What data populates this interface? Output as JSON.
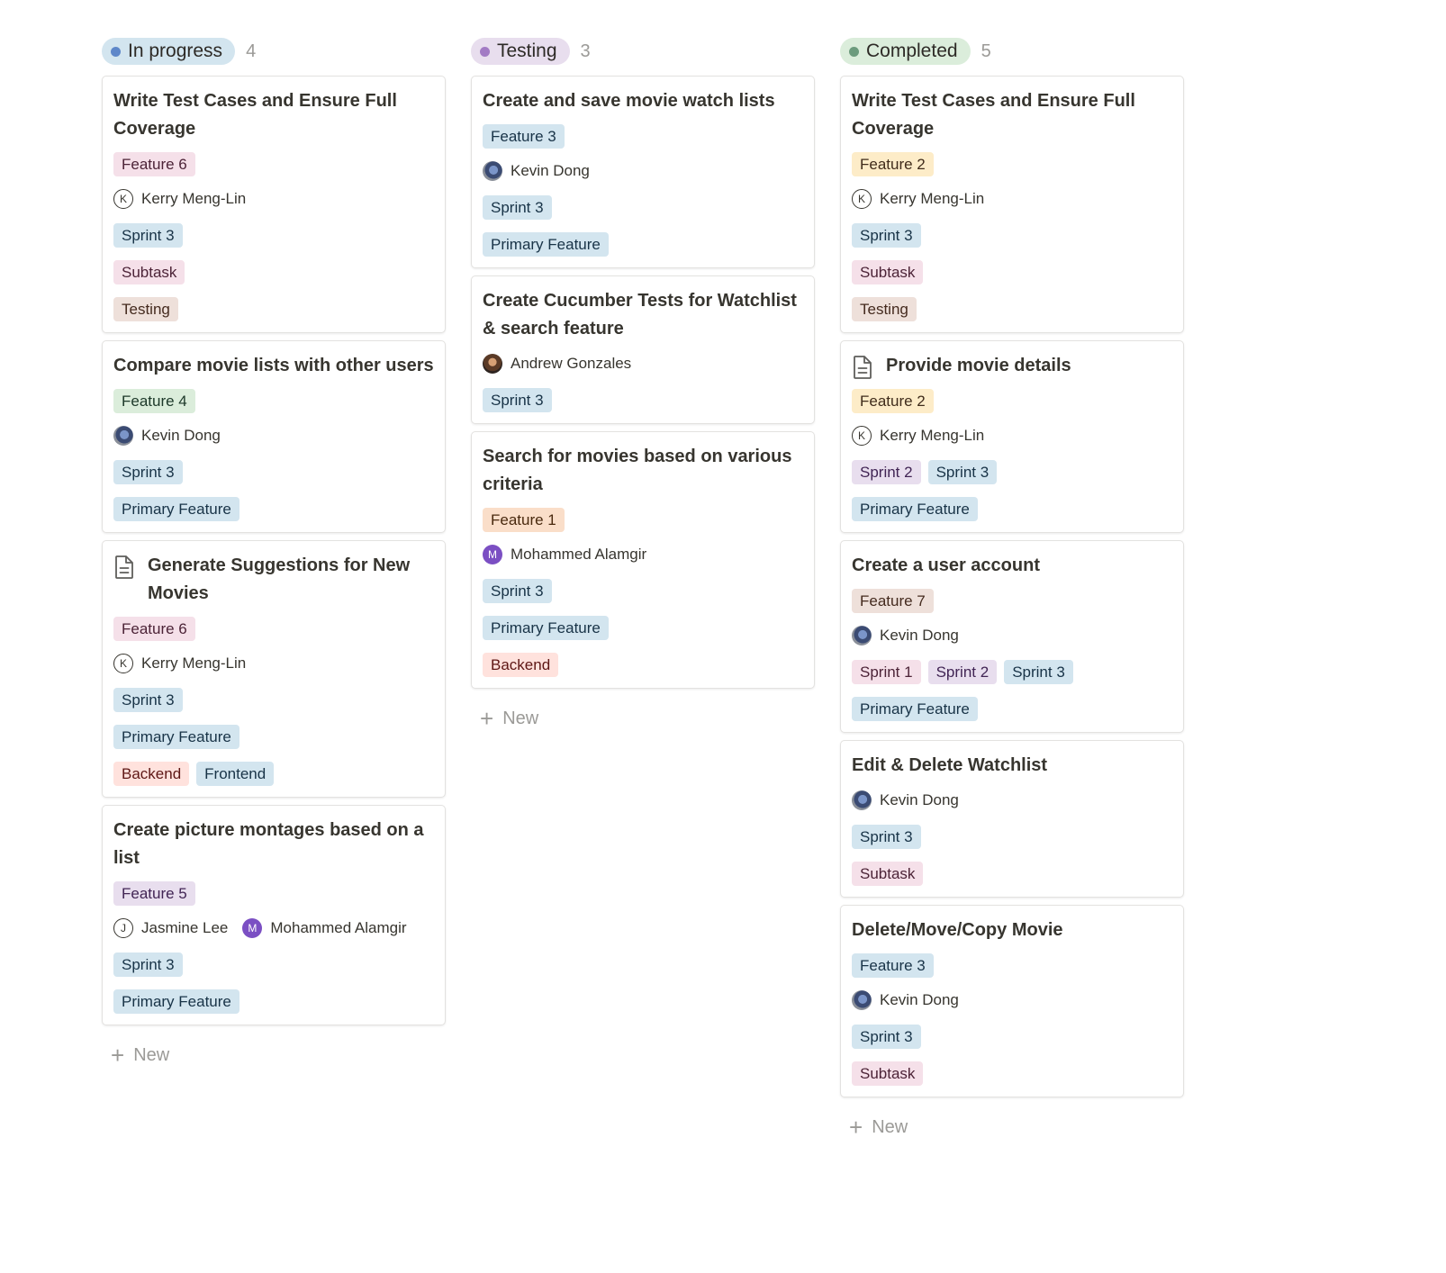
{
  "colors": {
    "tag_blue_bg": "#d3e5ef",
    "tag_blue_fg": "#183347",
    "tag_pink_bg": "#f5e0e9",
    "tag_pink_fg": "#4c2337",
    "tag_brown_bg": "#eee0da",
    "tag_brown_fg": "#442a1e",
    "tag_green_bg": "#dbeddb",
    "tag_green_fg": "#1c3829",
    "tag_purple_bg": "#e8deee",
    "tag_purple_fg": "#412454",
    "tag_yellow_bg": "#fdecc8",
    "tag_yellow_fg": "#402c1b",
    "tag_orange_bg": "#fadec9",
    "tag_orange_fg": "#49290e",
    "tag_red_bg": "#ffe2dd",
    "tag_red_fg": "#5d1715"
  },
  "columns": [
    {
      "status": "In progress",
      "status_bg": "#d3e5ef",
      "dot_color": "#5e87c9",
      "count": "4",
      "new_label": "New",
      "cards": [
        {
          "title": "Write Test Cases and Ensure Full Coverage",
          "has_doc_icon": false,
          "feature": {
            "label": "Feature 6",
            "color": "pink"
          },
          "people": [
            {
              "name": "Kerry Meng-Lin",
              "avatar": "letter",
              "initial": "K"
            }
          ],
          "sprints": [
            {
              "label": "Sprint 3",
              "color": "blue"
            }
          ],
          "extra_rows": [
            [
              {
                "label": "Subtask",
                "color": "pink"
              }
            ],
            [
              {
                "label": "Testing",
                "color": "brown"
              }
            ]
          ]
        },
        {
          "title": "Compare movie lists with other users",
          "has_doc_icon": false,
          "feature": {
            "label": "Feature 4",
            "color": "green"
          },
          "people": [
            {
              "name": "Kevin Dong",
              "avatar": "photo-kevin",
              "initial": ""
            }
          ],
          "sprints": [
            {
              "label": "Sprint 3",
              "color": "blue"
            }
          ],
          "extra_rows": [
            [
              {
                "label": "Primary Feature",
                "color": "blue"
              }
            ]
          ]
        },
        {
          "title": "Generate Suggestions for New Movies",
          "has_doc_icon": true,
          "feature": {
            "label": "Feature 6",
            "color": "pink"
          },
          "people": [
            {
              "name": "Kerry Meng-Lin",
              "avatar": "letter",
              "initial": "K"
            }
          ],
          "sprints": [
            {
              "label": "Sprint 3",
              "color": "blue"
            }
          ],
          "extra_rows": [
            [
              {
                "label": "Primary Feature",
                "color": "blue"
              }
            ],
            [
              {
                "label": "Backend",
                "color": "red"
              },
              {
                "label": "Frontend",
                "color": "blue"
              }
            ]
          ]
        },
        {
          "title": "Create picture montages based on a list",
          "has_doc_icon": false,
          "feature": {
            "label": "Feature 5",
            "color": "purple"
          },
          "people": [
            {
              "name": "Jasmine Lee",
              "avatar": "letter",
              "initial": "J"
            },
            {
              "name": "Mohammed Alamgir",
              "avatar": "purple",
              "initial": "M"
            }
          ],
          "sprints": [
            {
              "label": "Sprint 3",
              "color": "blue"
            }
          ],
          "extra_rows": [
            [
              {
                "label": "Primary Feature",
                "color": "blue"
              }
            ]
          ]
        }
      ]
    },
    {
      "status": "Testing",
      "status_bg": "#e8deee",
      "dot_color": "#a27bc4",
      "count": "3",
      "new_label": "New",
      "cards": [
        {
          "title": "Create and save movie watch lists",
          "has_doc_icon": false,
          "feature": {
            "label": "Feature 3",
            "color": "blue"
          },
          "people": [
            {
              "name": "Kevin Dong",
              "avatar": "photo-kevin",
              "initial": ""
            }
          ],
          "sprints": [
            {
              "label": "Sprint 3",
              "color": "blue"
            }
          ],
          "extra_rows": [
            [
              {
                "label": "Primary Feature",
                "color": "blue"
              }
            ]
          ]
        },
        {
          "title": "Create Cucumber Tests for Watchlist & search feature",
          "has_doc_icon": false,
          "feature": null,
          "people": [
            {
              "name": "Andrew Gonzales",
              "avatar": "photo-andrew",
              "initial": ""
            }
          ],
          "sprints": [
            {
              "label": "Sprint 3",
              "color": "blue"
            }
          ],
          "extra_rows": []
        },
        {
          "title": "Search for movies based on various criteria",
          "has_doc_icon": false,
          "feature": {
            "label": "Feature 1",
            "color": "orange"
          },
          "people": [
            {
              "name": "Mohammed Alamgir",
              "avatar": "purple",
              "initial": "M"
            }
          ],
          "sprints": [
            {
              "label": "Sprint 3",
              "color": "blue"
            }
          ],
          "extra_rows": [
            [
              {
                "label": "Primary Feature",
                "color": "blue"
              }
            ],
            [
              {
                "label": "Backend",
                "color": "red"
              }
            ]
          ]
        }
      ]
    },
    {
      "status": "Completed",
      "status_bg": "#dbeddb",
      "dot_color": "#6c9b7d",
      "count": "5",
      "new_label": "New",
      "cards": [
        {
          "title": "Write Test Cases and Ensure Full Coverage",
          "has_doc_icon": false,
          "feature": {
            "label": "Feature 2",
            "color": "yellow"
          },
          "people": [
            {
              "name": "Kerry Meng-Lin",
              "avatar": "letter",
              "initial": "K"
            }
          ],
          "sprints": [
            {
              "label": "Sprint 3",
              "color": "blue"
            }
          ],
          "extra_rows": [
            [
              {
                "label": "Subtask",
                "color": "pink"
              }
            ],
            [
              {
                "label": "Testing",
                "color": "brown"
              }
            ]
          ]
        },
        {
          "title": "Provide movie details",
          "has_doc_icon": true,
          "feature": {
            "label": "Feature 2",
            "color": "yellow"
          },
          "people": [
            {
              "name": "Kerry Meng-Lin",
              "avatar": "letter",
              "initial": "K"
            }
          ],
          "sprints": [
            {
              "label": "Sprint 2",
              "color": "purple"
            },
            {
              "label": "Sprint 3",
              "color": "blue"
            }
          ],
          "extra_rows": [
            [
              {
                "label": "Primary Feature",
                "color": "blue"
              }
            ]
          ]
        },
        {
          "title": "Create a user account",
          "has_doc_icon": false,
          "feature": {
            "label": "Feature 7",
            "color": "brown"
          },
          "people": [
            {
              "name": "Kevin Dong",
              "avatar": "photo-kevin",
              "initial": ""
            }
          ],
          "sprints": [
            {
              "label": "Sprint 1",
              "color": "pink"
            },
            {
              "label": "Sprint 2",
              "color": "purple"
            },
            {
              "label": "Sprint 3",
              "color": "blue"
            }
          ],
          "extra_rows": [
            [
              {
                "label": "Primary Feature",
                "color": "blue"
              }
            ]
          ]
        },
        {
          "title": "Edit & Delete Watchlist",
          "has_doc_icon": false,
          "feature": null,
          "people": [
            {
              "name": "Kevin Dong",
              "avatar": "photo-kevin",
              "initial": ""
            }
          ],
          "sprints": [
            {
              "label": "Sprint 3",
              "color": "blue"
            }
          ],
          "extra_rows": [
            [
              {
                "label": "Subtask",
                "color": "pink"
              }
            ]
          ]
        },
        {
          "title": "Delete/Move/Copy Movie",
          "has_doc_icon": false,
          "feature": {
            "label": "Feature 3",
            "color": "blue"
          },
          "people": [
            {
              "name": "Kevin Dong",
              "avatar": "photo-kevin",
              "initial": ""
            }
          ],
          "sprints": [
            {
              "label": "Sprint 3",
              "color": "blue"
            }
          ],
          "extra_rows": [
            [
              {
                "label": "Subtask",
                "color": "pink"
              }
            ]
          ]
        }
      ]
    }
  ]
}
